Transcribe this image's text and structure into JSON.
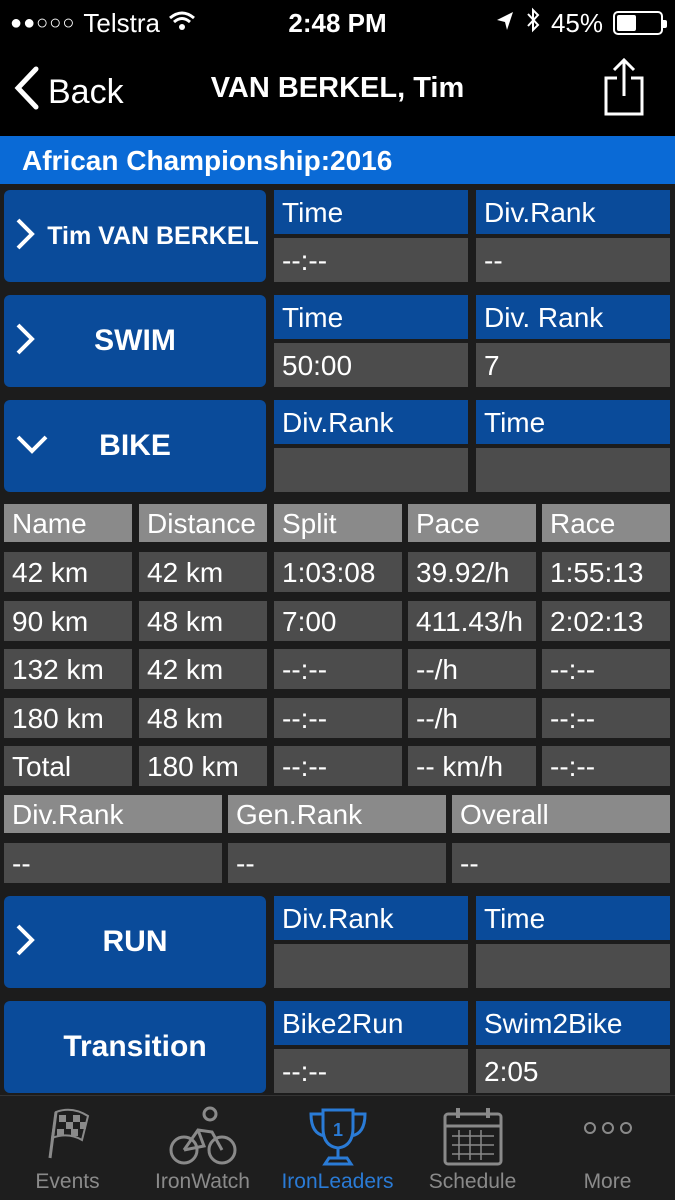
{
  "status": {
    "carrier": "Telstra",
    "signal_dots": "●●○○○",
    "time": "2:48 PM",
    "battery": "45%",
    "battery_level": 0.45
  },
  "nav": {
    "back_label": "Back",
    "title": "VAN BERKEL, Tim"
  },
  "event_title": "African Championship:2016",
  "athlete": {
    "name_button": "Tim VAN BERKEL",
    "col1_header": "Time",
    "col1_value": "--:--",
    "col2_header": "Div.Rank",
    "col2_value": "--"
  },
  "swim": {
    "label": "SWIM",
    "col1_header": "Time",
    "col1_value": "50:00",
    "col2_header": "Div. Rank",
    "col2_value": "7"
  },
  "bike": {
    "label": "BIKE",
    "col1_header": "Div.Rank",
    "col1_value": "",
    "col2_header": "Time",
    "col2_value": "",
    "splits_headers": [
      "Name",
      "Distance",
      "Split",
      "Pace",
      "Race"
    ],
    "splits_rows": [
      [
        "42 km",
        "42 km",
        "1:03:08",
        "39.92/h",
        "1:55:13"
      ],
      [
        "90 km",
        "48 km",
        "7:00",
        "411.43/h",
        "2:02:13"
      ],
      [
        "132 km",
        "42 km",
        "--:--",
        "--/h",
        "--:--"
      ],
      [
        "180 km",
        "48 km",
        "--:--",
        "--/h",
        "--:--"
      ],
      [
        "Total",
        "180 km",
        "--:--",
        "-- km/h",
        "--:--"
      ]
    ],
    "rank_headers": [
      "Div.Rank",
      "Gen.Rank",
      "Overall"
    ],
    "rank_values": [
      "--",
      "--",
      "--"
    ]
  },
  "run": {
    "label": "RUN",
    "col1_header": "Div.Rank",
    "col1_value": "",
    "col2_header": "Time",
    "col2_value": ""
  },
  "transition": {
    "label": "Transition",
    "col1_header": "Bike2Run",
    "col1_value": "--:--",
    "col2_header": "Swim2Bike",
    "col2_value": "2:05"
  },
  "tabs": [
    {
      "label": "Events",
      "icon": "checkered-flag-icon"
    },
    {
      "label": "IronWatch",
      "icon": "cyclist-icon"
    },
    {
      "label": "IronLeaders",
      "icon": "trophy-icon",
      "active": true
    },
    {
      "label": "Schedule",
      "icon": "calendar-icon"
    },
    {
      "label": "More",
      "icon": "more-dots-icon"
    }
  ],
  "colors": {
    "accent": "#0a6ad6",
    "header_blue": "#0a4b9a",
    "cell_gray": "#4c4c4c",
    "header_gray": "#8a8a8a"
  }
}
